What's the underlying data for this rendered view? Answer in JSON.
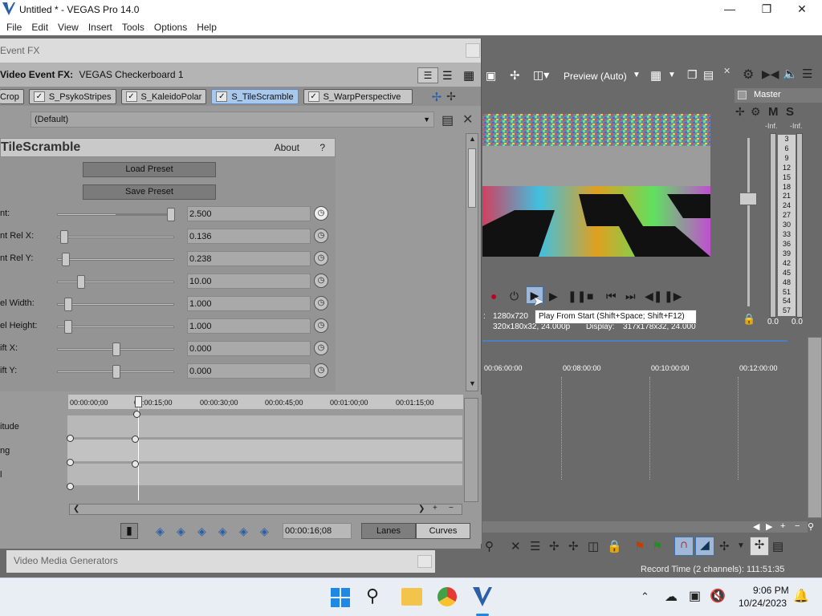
{
  "window": {
    "title": "Untitled * - VEGAS Pro 14.0"
  },
  "menu": [
    "File",
    "Edit",
    "View",
    "Insert",
    "Tools",
    "Options",
    "Help"
  ],
  "event_fx": {
    "title": "Event FX",
    "subtitle_label": "Video Event FX:",
    "subtitle_value": "VEGAS Checkerboard 1",
    "chain": [
      {
        "label": "Crop",
        "selected": false
      },
      {
        "label": "S_PsykoStripes",
        "selected": false
      },
      {
        "label": "S_KaleidoPolar",
        "selected": false
      },
      {
        "label": "S_TileScramble",
        "selected": true
      },
      {
        "label": "S_WarpPerspective",
        "selected": false
      }
    ],
    "preset": "(Default)",
    "plugin": {
      "name": "TileScramble",
      "about": "About",
      "help": "?",
      "load_preset": "Load Preset",
      "save_preset": "Save Preset",
      "params": [
        {
          "label": "nt:",
          "value": "2.500",
          "pos": 1.0
        },
        {
          "label": "nt Rel X:",
          "value": "0.136",
          "pos": 0.02
        },
        {
          "label": "nt Rel Y:",
          "value": "0.238",
          "pos": 0.04
        },
        {
          "label": "",
          "value": "10.00",
          "pos": 0.18
        },
        {
          "label": "el Width:",
          "value": "1.000",
          "pos": 0.06
        },
        {
          "label": "el Height:",
          "value": "1.000",
          "pos": 0.06
        },
        {
          "label": "ift X:",
          "value": "0.000",
          "pos": 0.5
        },
        {
          "label": "ift Y:",
          "value": "0.000",
          "pos": 0.5
        }
      ]
    },
    "keyframes": {
      "ruler": [
        "00:00:00;00",
        "00:00:15;00",
        "00:00:30;00",
        "00:00:45;00",
        "00:01:00;00",
        "00:01:15;00"
      ],
      "lanes": [
        "itude",
        "ng",
        "l"
      ],
      "time": "00:00:16;08",
      "lanes_btn": "Lanes",
      "curves_btn": "Curves"
    }
  },
  "preview": {
    "quality": "Preview (Auto)",
    "project_label": ":",
    "project_value": "1280x720",
    "preview_value": "320x180x32, 24.000p",
    "display_label": "Display:",
    "display_value": "317x178x32, 24.000"
  },
  "tooltip": "Play From Start (Shift+Space; Shift+F12)",
  "mixer": {
    "title": "Master",
    "btn_m": "M",
    "btn_s": "S",
    "inf_left": "-Inf.",
    "inf_right": "-Inf.",
    "scale": [
      "3",
      "6",
      "9",
      "12",
      "15",
      "18",
      "21",
      "24",
      "27",
      "30",
      "33",
      "36",
      "39",
      "42",
      "45",
      "48",
      "51",
      "54",
      "57"
    ],
    "level_left": "0.0",
    "level_right": "0.0"
  },
  "timeline": {
    "ticks": [
      "00:06:00:00",
      "00:08:00:00",
      "00:10:00:00",
      "00:12:00:00"
    ]
  },
  "media_generators": "Video Media Generators",
  "status": "Record Time (2 channels): 111:51:35",
  "clock": {
    "time": "9:06 PM",
    "date": "10/24/2023"
  },
  "colors": {
    "accent": "#5f89c0",
    "bg": "#6a6a6a"
  }
}
